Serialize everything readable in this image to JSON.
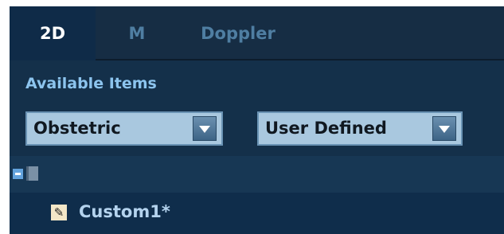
{
  "tabs": [
    {
      "label": "2D",
      "active": true
    },
    {
      "label": "M",
      "active": false
    },
    {
      "label": "Doppler",
      "active": false
    }
  ],
  "available_items": {
    "label": "Available Items",
    "exam_select": {
      "value": "Obstetric"
    },
    "group_select": {
      "value": "User Defined"
    }
  },
  "tree": {
    "root": {
      "expanded": true,
      "icon": "book-icon"
    },
    "items": [
      {
        "label": "Custom1*",
        "icon": "measurement-tool-icon"
      }
    ]
  },
  "colors": {
    "panel_bg": "#14304a",
    "tab_active_bg": "#0f2b48",
    "label_blue": "#8cc4ee",
    "select_bg": "#a9c8df"
  }
}
